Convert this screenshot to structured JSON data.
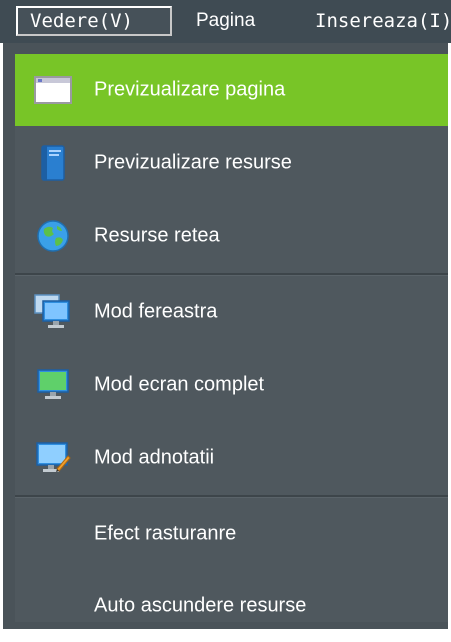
{
  "menubar": {
    "items": [
      {
        "label": "Vedere(V)"
      },
      {
        "label": "Pagina"
      },
      {
        "label": "Insereaza(I)"
      }
    ]
  },
  "dropdown": {
    "groups": [
      {
        "items": [
          {
            "label": "Previzualizare pagina",
            "icon": "page-preview-icon",
            "active": true
          },
          {
            "label": "Previzualizare resurse",
            "icon": "book-icon",
            "active": false
          },
          {
            "label": "Resurse retea",
            "icon": "globe-icon",
            "active": false
          }
        ]
      },
      {
        "items": [
          {
            "label": "Mod fereastra",
            "icon": "window-monitor-icon",
            "active": false
          },
          {
            "label": "Mod ecran complet",
            "icon": "fullscreen-monitor-icon",
            "active": false
          },
          {
            "label": "Mod adnotatii",
            "icon": "annotation-monitor-icon",
            "active": false
          }
        ]
      },
      {
        "items": [
          {
            "label": "Efect rasturanre",
            "icon": "",
            "active": false
          },
          {
            "label": "Auto ascundere resurse",
            "icon": "",
            "active": false
          }
        ]
      }
    ]
  },
  "colors": {
    "menubar_bg": "#3f4b53",
    "menu_bg": "#4f585e",
    "highlight": "#78c527",
    "text": "#ffffff"
  }
}
